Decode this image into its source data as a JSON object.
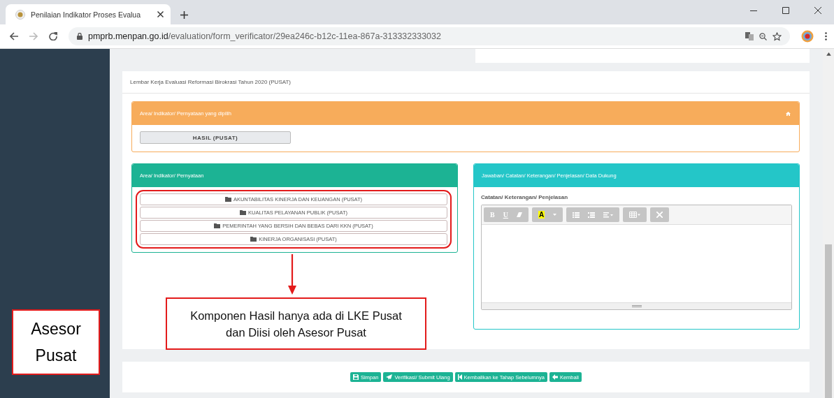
{
  "browser": {
    "tab_title": "Penilaian Indikator Proses Evalua",
    "url_host": "pmprb.menpan.go.id",
    "url_path": "/evaluation/form_verificator/29ea246c-b12c-11ea-867a-313332333032"
  },
  "sidebar": {
    "annotation": "Asesor Pusat"
  },
  "form": {
    "title": "Lembar Kerja Evaluasi Reformasi Birokrasi Tahun 2020 (PUSAT)",
    "selected_panel": {
      "title": "Area/ Indikator/ Pernyataan yang dipilih",
      "items": [
        "HASIL (PUSAT)"
      ]
    },
    "area_panel": {
      "title": "Area/ Indikator/ Pernyataan",
      "items": [
        {
          "label": "AKUNTABILITAS KINERJA DAN KEUANGAN (PUSAT)"
        },
        {
          "label": "KUALITAS PELAYANAN PUBLIK (PUSAT)"
        },
        {
          "label": "PEMERINTAH YANG BERSIH DAN BEBAS DARI KKN (PUSAT)"
        },
        {
          "label": "KINERJA ORGANISASI (PUSAT)"
        }
      ]
    },
    "callout": "Komponen Hasil hanya ada di LKE Pusat dan Diisi oleh Asesor Pusat",
    "answer_panel": {
      "title": "Jawaban/ Catatan/ Keterangan/ Penjelasan/ Data Dukung",
      "field_label": "Catatan/ Keterangan/ Penjelasan",
      "toolbar": [
        [
          {
            "kind": "bold",
            "label": "B"
          },
          {
            "kind": "underline",
            "label": "U"
          },
          {
            "kind": "eraser"
          }
        ],
        [
          {
            "kind": "highlight",
            "label": "A"
          },
          {
            "kind": "caret"
          }
        ],
        [
          {
            "kind": "bullets"
          },
          {
            "kind": "numbers"
          },
          {
            "kind": "align"
          }
        ],
        [
          {
            "kind": "table"
          }
        ],
        [
          {
            "kind": "fullscreen"
          }
        ]
      ]
    }
  },
  "actions": [
    {
      "kind": "save",
      "label": "Simpan"
    },
    {
      "kind": "send",
      "label": "Verifikasi/ Submit Ulang"
    },
    {
      "kind": "back-step",
      "label": "Kembalikan ke Tahap Sebelumnya"
    },
    {
      "kind": "back",
      "label": "Kembali"
    }
  ]
}
